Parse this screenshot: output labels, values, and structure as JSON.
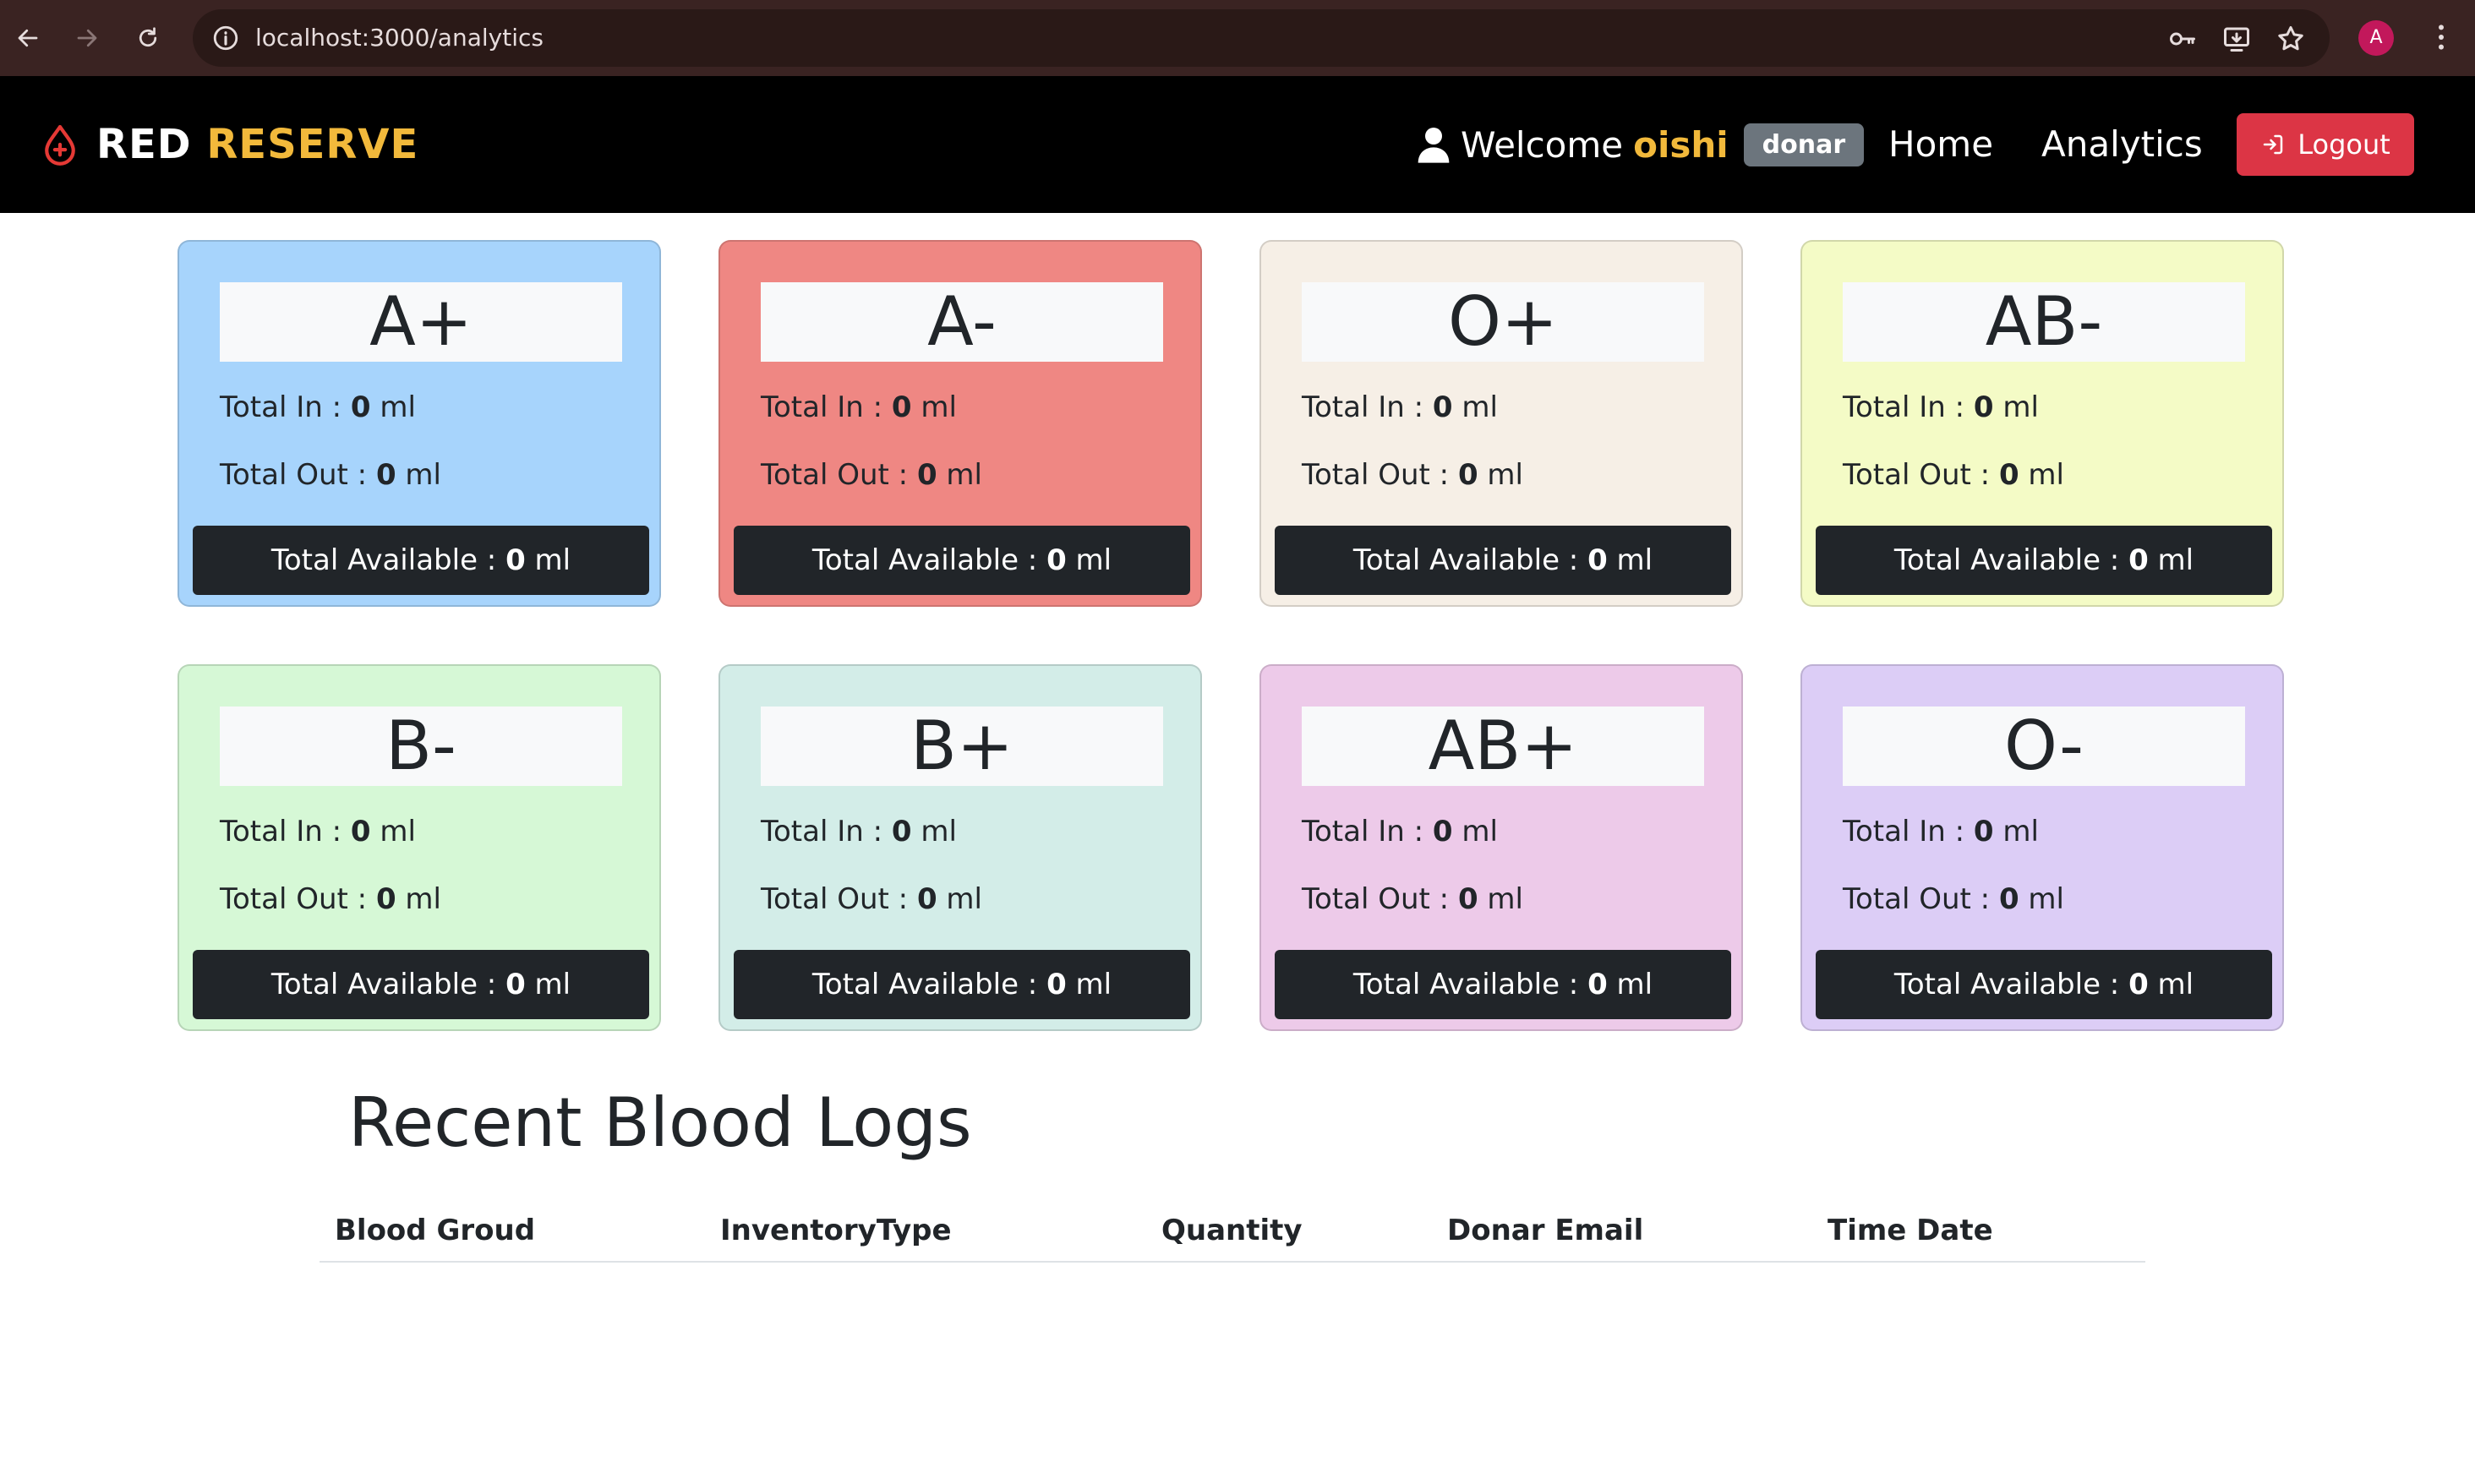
{
  "browser": {
    "url": "localhost:3000/analytics",
    "profile_initial": "A"
  },
  "navbar": {
    "brand_part1": "RED",
    "brand_part2": "RESERVE",
    "welcome_label": "Welcome",
    "user_name": "oishi",
    "role": "donar",
    "links": [
      "Home",
      "Analytics"
    ],
    "logout_label": "Logout"
  },
  "cards": [
    {
      "group": "A+",
      "total_in_label": "Total In :",
      "total_in": "0",
      "total_out_label": "Total Out :",
      "total_out": "0",
      "available_label": "Total Available :",
      "available": "0",
      "unit": "ml",
      "color": "#a7d4fc"
    },
    {
      "group": "A-",
      "total_in_label": "Total In :",
      "total_in": "0",
      "total_out_label": "Total Out :",
      "total_out": "0",
      "available_label": "Total Available :",
      "available": "0",
      "unit": "ml",
      "color": "#ef8783"
    },
    {
      "group": "O+",
      "total_in_label": "Total In :",
      "total_in": "0",
      "total_out_label": "Total Out :",
      "total_out": "0",
      "available_label": "Total Available :",
      "available": "0",
      "unit": "ml",
      "color": "#f6efe6"
    },
    {
      "group": "AB-",
      "total_in_label": "Total In :",
      "total_in": "0",
      "total_out_label": "Total Out :",
      "total_out": "0",
      "available_label": "Total Available :",
      "available": "0",
      "unit": "ml",
      "color": "#f4fbc6"
    },
    {
      "group": "B-",
      "total_in_label": "Total In :",
      "total_in": "0",
      "total_out_label": "Total Out :",
      "total_out": "0",
      "available_label": "Total Available :",
      "available": "0",
      "unit": "ml",
      "color": "#d6f8d6"
    },
    {
      "group": "B+",
      "total_in_label": "Total In :",
      "total_in": "0",
      "total_out_label": "Total Out :",
      "total_out": "0",
      "available_label": "Total Available :",
      "available": "0",
      "unit": "ml",
      "color": "#d3ede8"
    },
    {
      "group": "AB+",
      "total_in_label": "Total In :",
      "total_in": "0",
      "total_out_label": "Total Out :",
      "total_out": "0",
      "available_label": "Total Available :",
      "available": "0",
      "unit": "ml",
      "color": "#edcae9"
    },
    {
      "group": "O-",
      "total_in_label": "Total In :",
      "total_in": "0",
      "total_out_label": "Total Out :",
      "total_out": "0",
      "available_label": "Total Available :",
      "available": "0",
      "unit": "ml",
      "color": "#dccdf6"
    }
  ],
  "logs": {
    "title": "Recent Blood Logs",
    "columns": [
      "Blood Groud",
      "InventoryType",
      "Quantity",
      "Donar Email",
      "Time Date"
    ],
    "rows": []
  }
}
